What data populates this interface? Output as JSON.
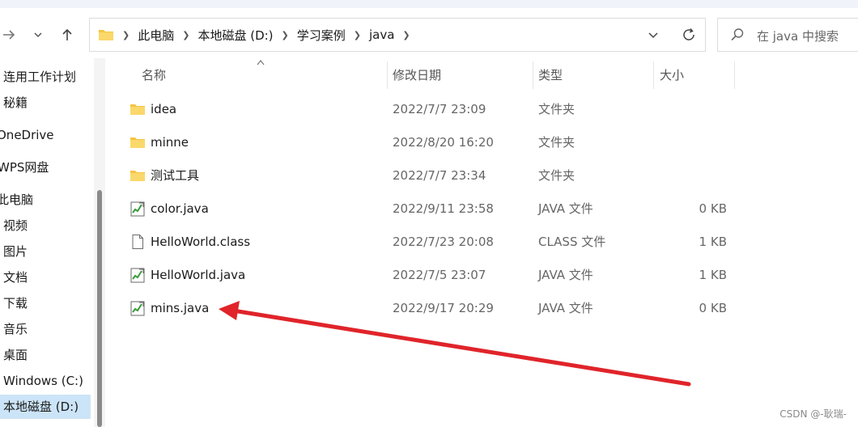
{
  "address_bar": {
    "breadcrumbs": [
      "此电脑",
      "本地磁盘 (D:)",
      "学习案例",
      "java"
    ]
  },
  "search": {
    "placeholder": "在 java 中搜索"
  },
  "sidebar": {
    "items": [
      {
        "label": "连用工作计划"
      },
      {
        "label": "秘籍"
      },
      {
        "label": "OneDrive"
      },
      {
        "label": "WPS网盘"
      },
      {
        "label": "此电脑"
      },
      {
        "label": "视频"
      },
      {
        "label": "图片"
      },
      {
        "label": "文档"
      },
      {
        "label": "下载"
      },
      {
        "label": "音乐"
      },
      {
        "label": "桌面"
      },
      {
        "label": "Windows (C:)"
      },
      {
        "label": "本地磁盘 (D:)"
      }
    ],
    "selected": "本地磁盘 (D:)"
  },
  "columns": {
    "name": "名称",
    "modified": "修改日期",
    "type": "类型",
    "size": "大小"
  },
  "files": [
    {
      "name": "idea",
      "modified": "2022/7/7 23:09",
      "type": "文件夹",
      "size": "",
      "icon": "folder-icon"
    },
    {
      "name": "minne",
      "modified": "2022/8/20 16:20",
      "type": "文件夹",
      "size": "",
      "icon": "folder-icon"
    },
    {
      "name": "测试工具",
      "modified": "2022/7/7 23:34",
      "type": "文件夹",
      "size": "",
      "icon": "folder-icon"
    },
    {
      "name": "color.java",
      "modified": "2022/9/11 23:58",
      "type": "JAVA 文件",
      "size": "0 KB",
      "icon": "java-file-icon"
    },
    {
      "name": "HelloWorld.class",
      "modified": "2022/7/23 20:08",
      "type": "CLASS 文件",
      "size": "1 KB",
      "icon": "blank-file-icon"
    },
    {
      "name": "HelloWorld.java",
      "modified": "2022/7/5 23:07",
      "type": "JAVA 文件",
      "size": "1 KB",
      "icon": "java-file-icon"
    },
    {
      "name": "mins.java",
      "modified": "2022/9/17 20:29",
      "type": "JAVA 文件",
      "size": "0 KB",
      "icon": "java-file-icon"
    }
  ],
  "watermark": "CSDN @-耿瑞-",
  "colors": {
    "selected_bg": "#cce4f7",
    "annotation_arrow": "#e0242a",
    "folder": "#f5c542"
  }
}
